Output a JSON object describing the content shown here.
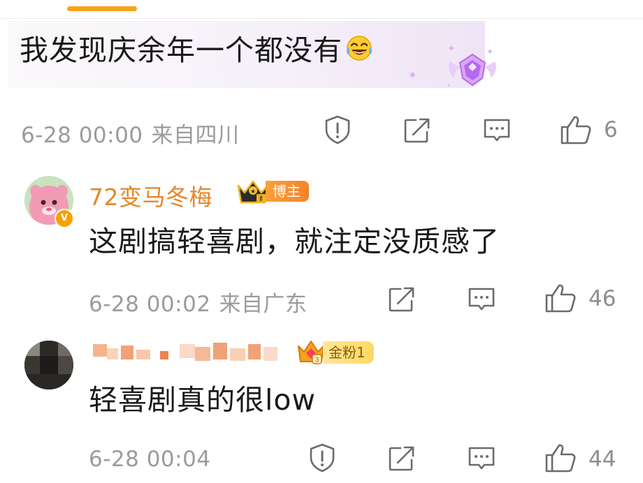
{
  "comments": [
    {
      "text": "我发现庆余年一个都没有",
      "emoji_icon": "laughing-tears-emoji",
      "date": "6-28 00:00",
      "location": "来自四川",
      "likes": "6"
    },
    {
      "username": "72变马冬梅",
      "user_tag": "博主",
      "crown_level": "Ⅱ",
      "text": "这剧搞轻喜剧，就注定没质感了",
      "date": "6-28 00:02",
      "location": "来自广东",
      "likes": "46"
    },
    {
      "fan_tag": "金粉1",
      "crown_level": "3",
      "text": "轻喜剧真的很low",
      "date": "6-28 00:04",
      "location": "",
      "likes": "44"
    }
  ],
  "colors": {
    "accent": "#f7a21b",
    "username": "#e8862a",
    "meta_text": "#9b9b9b",
    "icon": "#6b6b6b"
  }
}
